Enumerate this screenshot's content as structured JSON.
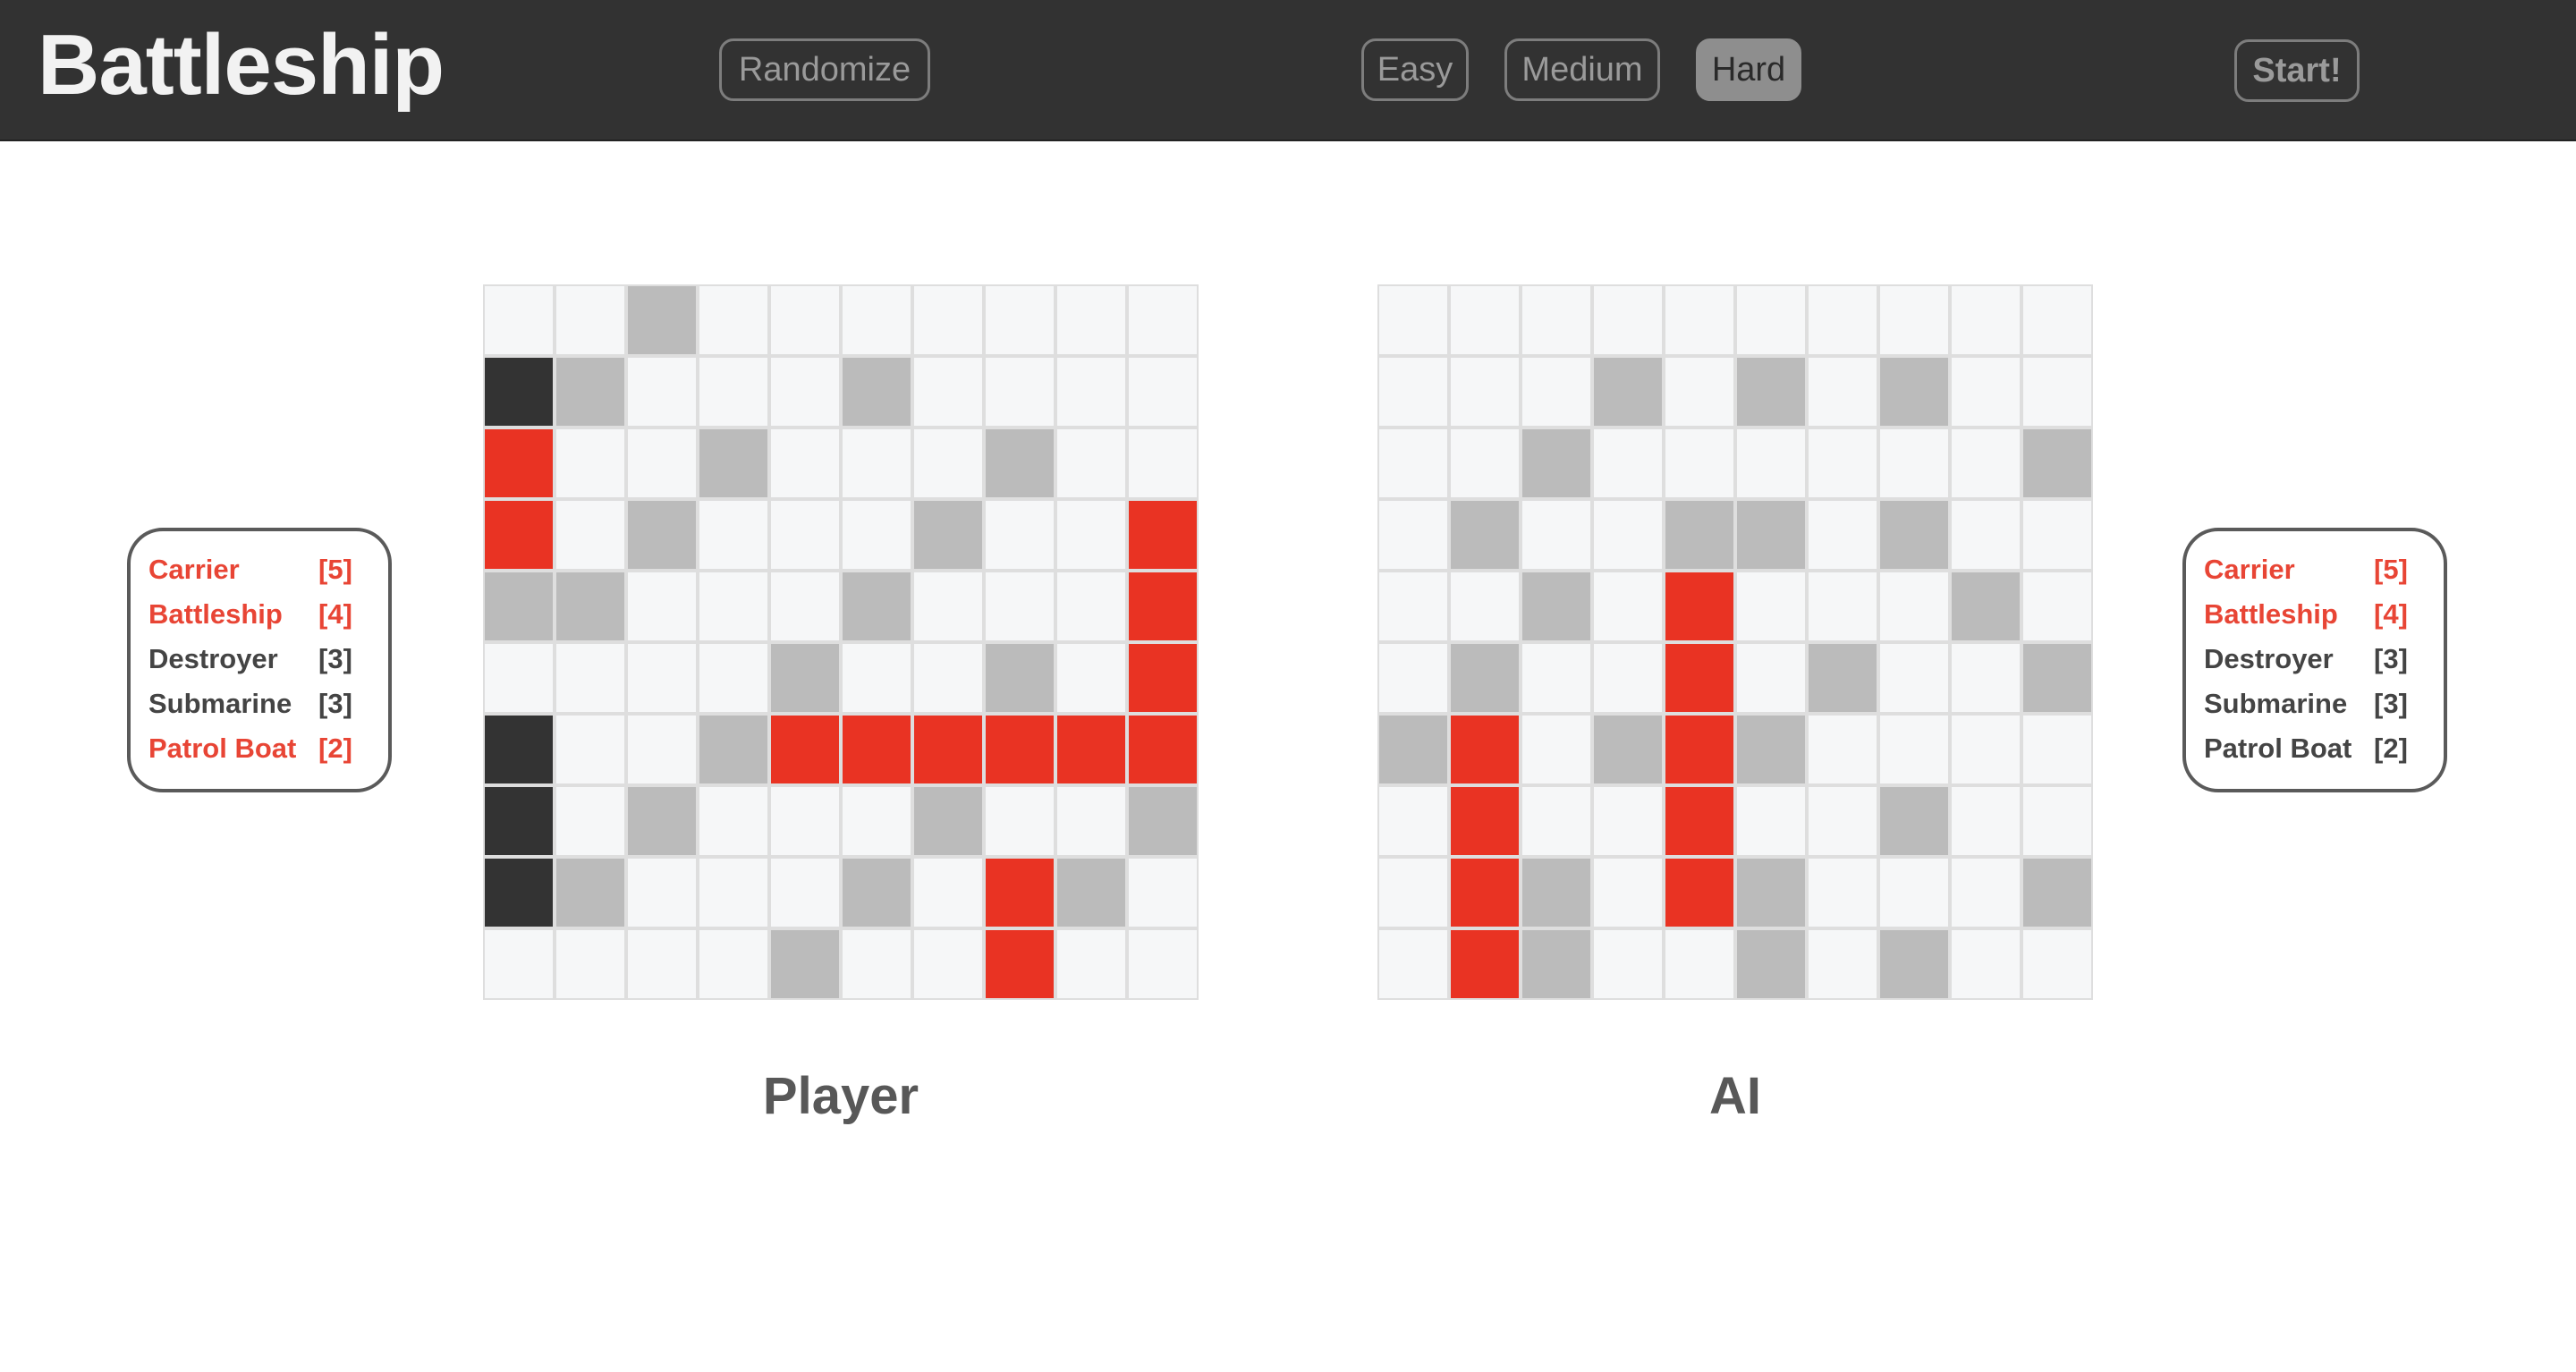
{
  "header": {
    "title": "Battleship",
    "randomize_label": "Randomize",
    "difficulty": [
      {
        "label": "Easy",
        "active": false
      },
      {
        "label": "Medium",
        "active": false
      },
      {
        "label": "Hard",
        "active": true
      }
    ],
    "start_label": "Start!"
  },
  "colors": {
    "header_bg": "#323232",
    "cell_empty": "#f6f7f8",
    "cell_miss": "#bbbbbb",
    "cell_hit": "#e93323",
    "cell_ship": "#333333",
    "sunk_text": "#e84535"
  },
  "cell_legend": {
    "0": "empty",
    "1": "miss",
    "2": "hit",
    "3": "ship"
  },
  "player": {
    "label": "Player",
    "fleet": [
      {
        "name": "Carrier",
        "size": "[5]",
        "sunk": true
      },
      {
        "name": "Battleship",
        "size": "[4]",
        "sunk": true
      },
      {
        "name": "Destroyer",
        "size": "[3]",
        "sunk": false
      },
      {
        "name": "Submarine",
        "size": "[3]",
        "sunk": false
      },
      {
        "name": "Patrol Boat",
        "size": "[2]",
        "sunk": true
      }
    ],
    "grid": [
      [
        0,
        0,
        1,
        0,
        0,
        0,
        0,
        0,
        0,
        0
      ],
      [
        3,
        1,
        0,
        0,
        0,
        1,
        0,
        0,
        0,
        0
      ],
      [
        2,
        0,
        0,
        1,
        0,
        0,
        0,
        1,
        0,
        0
      ],
      [
        2,
        0,
        1,
        0,
        0,
        0,
        1,
        0,
        0,
        2
      ],
      [
        1,
        1,
        0,
        0,
        0,
        1,
        0,
        0,
        0,
        2
      ],
      [
        0,
        0,
        0,
        0,
        1,
        0,
        0,
        1,
        0,
        2
      ],
      [
        3,
        0,
        0,
        1,
        2,
        2,
        2,
        2,
        2,
        2
      ],
      [
        3,
        0,
        1,
        0,
        0,
        0,
        1,
        0,
        0,
        1
      ],
      [
        3,
        1,
        0,
        0,
        0,
        1,
        0,
        2,
        1,
        0
      ],
      [
        0,
        0,
        0,
        0,
        1,
        0,
        0,
        2,
        0,
        0
      ]
    ]
  },
  "ai": {
    "label": "AI",
    "fleet": [
      {
        "name": "Carrier",
        "size": "[5]",
        "sunk": true
      },
      {
        "name": "Battleship",
        "size": "[4]",
        "sunk": true
      },
      {
        "name": "Destroyer",
        "size": "[3]",
        "sunk": false
      },
      {
        "name": "Submarine",
        "size": "[3]",
        "sunk": false
      },
      {
        "name": "Patrol Boat",
        "size": "[2]",
        "sunk": false
      }
    ],
    "grid": [
      [
        0,
        0,
        0,
        0,
        0,
        0,
        0,
        0,
        0,
        0
      ],
      [
        0,
        0,
        0,
        1,
        0,
        1,
        0,
        1,
        0,
        0
      ],
      [
        0,
        0,
        1,
        0,
        0,
        0,
        0,
        0,
        0,
        1
      ],
      [
        0,
        1,
        0,
        0,
        1,
        1,
        0,
        1,
        0,
        0
      ],
      [
        0,
        0,
        1,
        0,
        2,
        0,
        0,
        0,
        1,
        0
      ],
      [
        0,
        1,
        0,
        0,
        2,
        0,
        1,
        0,
        0,
        1
      ],
      [
        1,
        2,
        0,
        1,
        2,
        1,
        0,
        0,
        0,
        0
      ],
      [
        0,
        2,
        0,
        0,
        2,
        0,
        0,
        1,
        0,
        0
      ],
      [
        0,
        2,
        1,
        0,
        2,
        1,
        0,
        0,
        0,
        1
      ],
      [
        0,
        2,
        1,
        0,
        0,
        1,
        0,
        1,
        0,
        0
      ]
    ]
  }
}
